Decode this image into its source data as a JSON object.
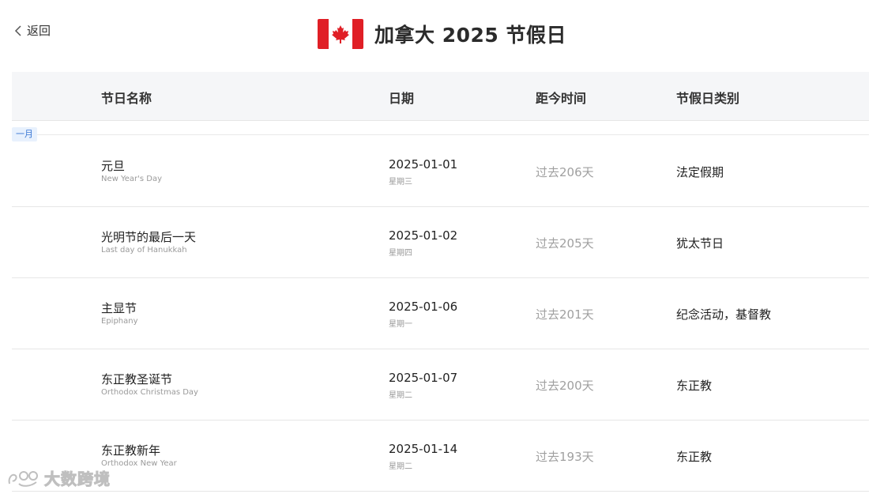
{
  "header": {
    "back_label": "返回",
    "title": "加拿大 2025 节假日"
  },
  "table": {
    "columns": [
      "节日名称",
      "日期",
      "距今时间",
      "节假日类别"
    ],
    "month_label": "一月",
    "rows": [
      {
        "name_cn": "元旦",
        "name_en": "New Year's Day",
        "date": "2025-01-01",
        "weekday": "星期三",
        "since": "过去206天",
        "type": "法定假期"
      },
      {
        "name_cn": "光明节的最后一天",
        "name_en": "Last day of Hanukkah",
        "date": "2025-01-02",
        "weekday": "星期四",
        "since": "过去205天",
        "type": "犹太节日"
      },
      {
        "name_cn": "主显节",
        "name_en": "Epiphany",
        "date": "2025-01-06",
        "weekday": "星期一",
        "since": "过去201天",
        "type": "纪念活动，基督教"
      },
      {
        "name_cn": "东正教圣诞节",
        "name_en": "Orthodox Christmas Day",
        "date": "2025-01-07",
        "weekday": "星期二",
        "since": "过去200天",
        "type": "东正教"
      },
      {
        "name_cn": "东正教新年",
        "name_en": "Orthodox New Year",
        "date": "2025-01-14",
        "weekday": "星期二",
        "since": "过去193天",
        "type": "东正教"
      }
    ]
  },
  "watermark": {
    "text": "大数跨境"
  },
  "colors": {
    "flag_red": "#e01f26",
    "accent_blue": "#3a78d4",
    "header_bg": "#f5f6f8"
  },
  "icons": {
    "back": "chevron-left-icon",
    "flag": "canada-flag-icon",
    "watermark_logo": "brand-logo-icon"
  }
}
